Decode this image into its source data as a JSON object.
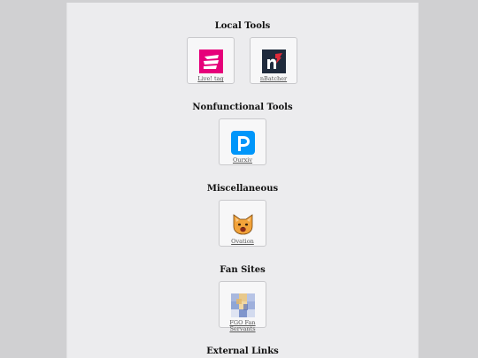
{
  "sections": [
    {
      "title": "Local Tools",
      "items": [
        {
          "label": "Live! tag",
          "icon": "livetag-icon",
          "color": "#e6007a"
        },
        {
          "label": "nBatcher",
          "icon": "nbatcher-icon",
          "color": "#1f2a3c"
        }
      ]
    },
    {
      "title": "Nonfunctional Tools",
      "items": [
        {
          "label": "Ourxiv",
          "icon": "pixiv-icon",
          "color": "#0096fa"
        }
      ]
    },
    {
      "title": "Miscellaneous",
      "items": [
        {
          "label": "Ovation",
          "icon": "cat-face-icon",
          "color": "#f2a33a"
        }
      ]
    },
    {
      "title": "Fan Sites",
      "items": [
        {
          "label": "FGO Fan Servants",
          "icon": "fgo-thumbnail-icon",
          "color": "#8fa6d6"
        }
      ]
    },
    {
      "title": "External Links",
      "items": []
    }
  ]
}
